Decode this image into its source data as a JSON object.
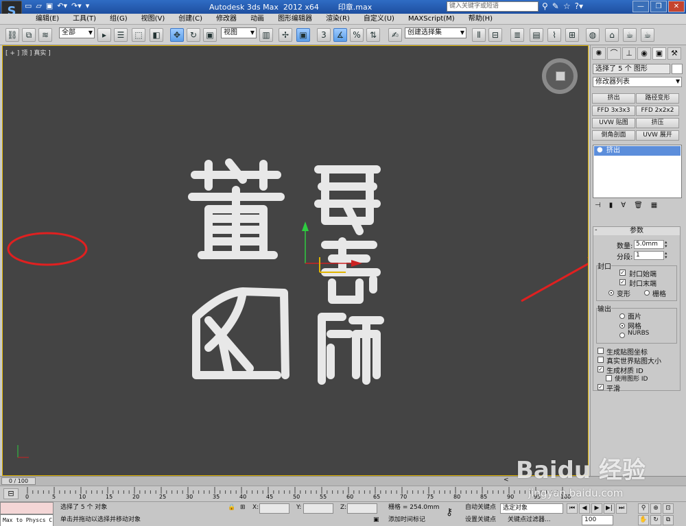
{
  "titlebar": {
    "title": "Autodesk 3ds Max  2012 x64        印章.max",
    "search_placeholder": "键入关键字或短语",
    "logo": "S"
  },
  "menu": [
    "编辑(E)",
    "工具(T)",
    "组(G)",
    "视图(V)",
    "创建(C)",
    "修改器",
    "动画",
    "图形编辑器",
    "渲染(R)",
    "自定义(U)",
    "MAXScript(M)",
    "帮助(H)"
  ],
  "toolbar": {
    "selection_filter": "全部",
    "reference_coord": "视图",
    "named_selection": "创建选择集"
  },
  "viewport": {
    "label": "[ + ] 顶 ] 真实 ]",
    "artwork_glyphs": [
      "董",
      "毅",
      "老",
      "飼",
      "師"
    ]
  },
  "command_panel": {
    "selection_info": "选择了 5 个 图形",
    "modifier_list": "修改器列表",
    "modifier_buttons": [
      "挤出",
      "路径变形",
      "FFD 3x3x3",
      "FFD 2x2x2",
      "UVW 贴图",
      "挤压",
      "倒角剖面",
      "UVW 展开"
    ],
    "stack_item": "挤出",
    "params": {
      "title": "参数",
      "amount_label": "数量:",
      "amount_value": "5.0mm",
      "segments_label": "分段:",
      "segments_value": "1",
      "capping_label": "封口",
      "cap_start": "封口始端",
      "cap_end": "封口末端",
      "morph": "变形",
      "grid": "栅格",
      "output_label": "输出",
      "patch": "面片",
      "mesh": "网格",
      "nurbs": "NURBS",
      "gen_map_coords": "生成贴图坐标",
      "real_world_map": "真实世界贴图大小",
      "gen_mat_ids": "生成材质 ID",
      "use_shape_ids": "使用图形 ID",
      "smooth": "平滑"
    }
  },
  "timeline": {
    "slider": "0 / 100",
    "ticks": [
      "0",
      "5",
      "10",
      "15",
      "20",
      "25",
      "30",
      "35",
      "40",
      "45",
      "50",
      "55",
      "60",
      "65",
      "70",
      "75",
      "80",
      "85",
      "90",
      "95",
      "100"
    ]
  },
  "status": {
    "listener_text": "Max to Physcs C",
    "prompt_line1": "选择了 5 个 对象",
    "prompt_line2": "单击并拖动以选择并移动对象",
    "x_label": "X:",
    "y_label": "Y:",
    "z_label": "Z:",
    "grid": "栅格 = 254.0mm",
    "add_time_tag": "添加时间标记",
    "auto_key": "自动关键点",
    "set_key": "设置关键点",
    "selected_object": "选定对象",
    "key_filters": "关键点过滤器...",
    "frame_value": "100"
  },
  "watermark": {
    "brand": "Baidu 经验",
    "url": "jingyan.baidu.com"
  },
  "colors": {
    "viewport_bg": "#444444",
    "active_border": "#e0b400",
    "annotation_red": "#e02020",
    "stack_highlight": "#5c8edb"
  }
}
